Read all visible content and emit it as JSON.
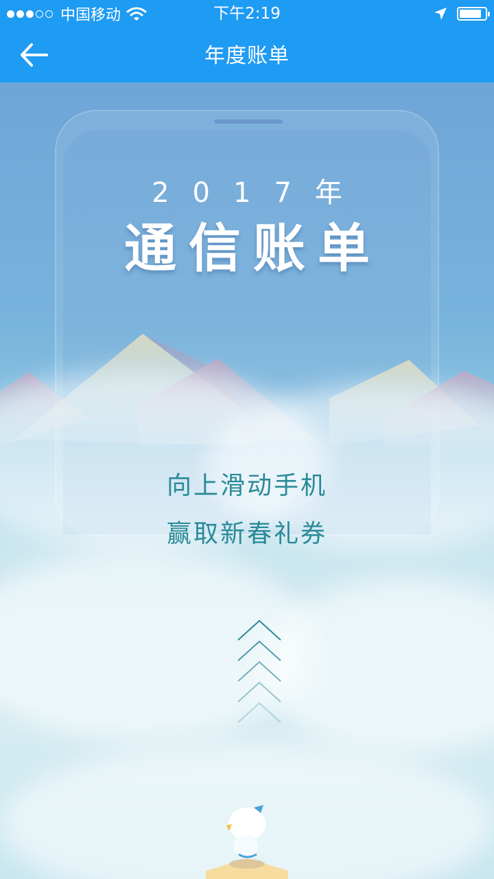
{
  "status_bar": {
    "signal_dots_filled": 3,
    "signal_dots_total": 5,
    "carrier": "中国移动",
    "wifi_icon": "wifi-icon",
    "time": "下午2:19",
    "location_icon": "location-arrow-icon",
    "battery_icon": "battery-icon",
    "battery_level": 0.85
  },
  "navbar": {
    "back_icon": "arrow-left-icon",
    "title": "年度账单"
  },
  "hero": {
    "year": "2017年",
    "title": "通信账单"
  },
  "prompt": {
    "line1": "向上滑动手机",
    "line2": "赢取新春礼券"
  },
  "swipe_hint": {
    "icon": "chevron-up-icon",
    "count": 5
  },
  "colors": {
    "primary": "#1e9bf3",
    "prompt_text": "#2a8a98"
  }
}
